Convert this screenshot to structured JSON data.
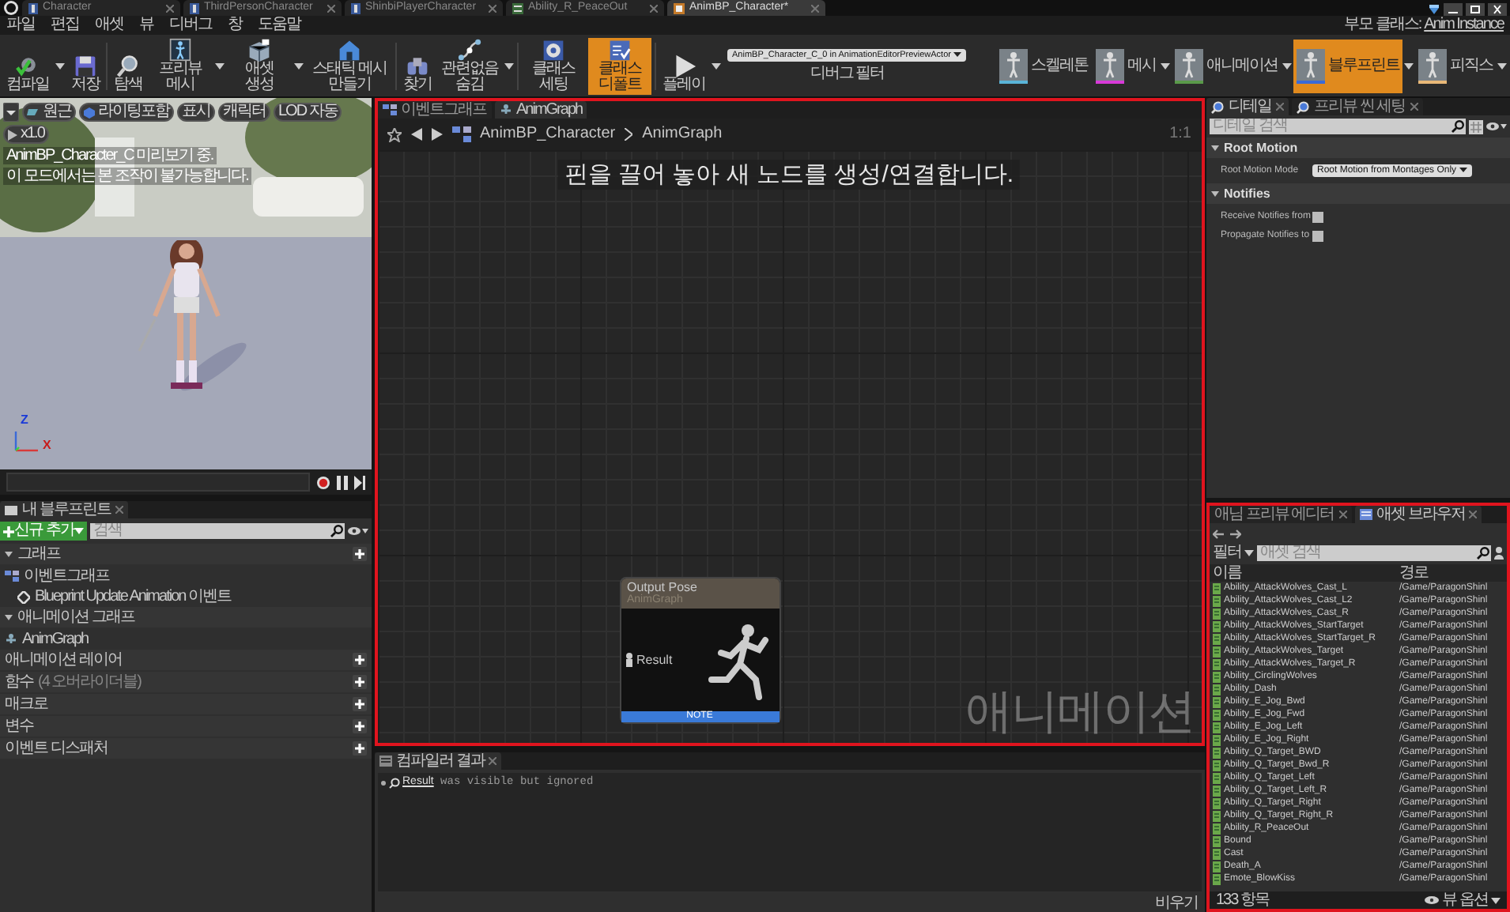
{
  "editor_tabs": [
    {
      "label": "Character",
      "kind": "blueprint",
      "selected": false
    },
    {
      "label": "ThirdPersonCharacter",
      "kind": "blueprint",
      "selected": false
    },
    {
      "label": "ShinbiPlayerCharacter",
      "kind": "blueprint",
      "selected": false
    },
    {
      "label": "Ability_R_PeaceOut",
      "kind": "sequence",
      "selected": false
    },
    {
      "label": "AnimBP_Character*",
      "kind": "animbp",
      "selected": true
    }
  ],
  "menu": [
    "파일",
    "편집",
    "애셋",
    "뷰",
    "디버그",
    "창",
    "도움말"
  ],
  "parent_class": {
    "label": "부모 클래스:",
    "value": "Anim Instance"
  },
  "toolbar": [
    {
      "label": "컴파일",
      "kind": "compile",
      "dropdown": true,
      "active": false
    },
    {
      "label": "저장",
      "kind": "save",
      "dropdown": false,
      "active": false
    },
    {
      "label": "탐색",
      "kind": "browse",
      "dropdown": false,
      "active": false
    },
    {
      "label": "프리뷰 메시",
      "kind": "preview",
      "dropdown": true,
      "active": false
    },
    {
      "label": "애셋 생성",
      "kind": "create",
      "dropdown": true,
      "active": false
    },
    {
      "label": "스태틱 메시 만들기",
      "kind": "house",
      "dropdown": false,
      "active": false
    },
    {
      "label": "찾기",
      "kind": "find",
      "dropdown": false,
      "active": false
    },
    {
      "label": "관련없음 숨김",
      "kind": "hide",
      "dropdown": true,
      "active": false
    },
    {
      "label": "클래스 세팅",
      "kind": "settings",
      "dropdown": false,
      "active": false
    },
    {
      "label": "클래스 디폴트",
      "kind": "defaults",
      "dropdown": false,
      "active": true
    },
    {
      "label": "플레이",
      "kind": "play",
      "dropdown": true,
      "active": false
    }
  ],
  "debug_filter": {
    "value": "AnimBP_Character_C_0 in AnimationEditorPreviewActor",
    "label": "디버그 필터"
  },
  "modes": [
    {
      "label": "스켈레톤",
      "color": "#5ab4d8",
      "dropdown": false,
      "selected": false
    },
    {
      "label": "메시",
      "color": "#d83ad8",
      "dropdown": true,
      "selected": false
    },
    {
      "label": "애니메이션",
      "color": "#5a9a4a",
      "dropdown": true,
      "selected": false
    },
    {
      "label": "블루프린트",
      "color": "#3a6ad8",
      "dropdown": true,
      "selected": true
    },
    {
      "label": "피직스",
      "color": "#e8b878",
      "dropdown": true,
      "selected": false
    }
  ],
  "viewport": {
    "buttons": [
      {
        "label": "원근",
        "kind": "perspective"
      },
      {
        "label": "라이팅포함",
        "kind": "lit"
      },
      {
        "label": "표시",
        "kind": "plain"
      },
      {
        "label": "캐릭터",
        "kind": "plain"
      },
      {
        "label": "LOD 자동",
        "kind": "plain"
      },
      {
        "label": "x1.0",
        "kind": "speed"
      }
    ],
    "messages": [
      "AnimBP_Character_C 미리보기 중.",
      "이 모드에서는 본 조작이 불가능합니다."
    ],
    "gizmo": [
      "Z",
      "X"
    ],
    "kind": "picture"
  },
  "my_blueprint": {
    "tab": "내 블루프린트",
    "add_button": "신규 추가",
    "search_placeholder": "검색",
    "sections": [
      {
        "label": "그래프",
        "add": true,
        "expanded": true,
        "children": [
          {
            "label": "이벤트그래프",
            "kind": "graph",
            "children": [
              {
                "label": "Blueprint Update Animation 이벤트",
                "kind": "event"
              }
            ]
          }
        ]
      },
      {
        "label": "애니메이션 그래프",
        "add": false,
        "expanded": true,
        "children": [
          {
            "label": "AnimGraph",
            "kind": "animgraph"
          }
        ]
      },
      {
        "label": "애니메이션 레이어",
        "add": true
      },
      {
        "label": "함수",
        "note": "(4 오버라이더블)",
        "add": true
      },
      {
        "label": "매크로",
        "add": true
      },
      {
        "label": "변수",
        "add": true
      },
      {
        "label": "이벤트 디스패처",
        "add": true
      }
    ]
  },
  "graph": {
    "tabs": [
      {
        "label": "이벤트그래프",
        "selected": false
      },
      {
        "label": "AnimGraph",
        "selected": true
      }
    ],
    "breadcrumb": [
      "AnimBP_Character",
      "AnimGraph"
    ],
    "zoom": "1:1",
    "hint": "핀을 끌어 놓아 새 노드를 생성/연결합니다.",
    "node": {
      "title": "Output Pose",
      "subtitle": "AnimGraph",
      "pin": "Result",
      "footer": "NOTE"
    },
    "watermark": "애니메이션"
  },
  "compiler": {
    "tab": "컴파일러 결과",
    "messages": [
      {
        "link": "Result",
        "text": "was visible but ignored"
      }
    ],
    "clear_button": "비우기"
  },
  "details": {
    "tabs": [
      {
        "label": "디테일",
        "selected": true
      },
      {
        "label": "프리뷰 씬 세팅",
        "selected": false
      }
    ],
    "search_placeholder": "디테일 검색",
    "categories": [
      {
        "title": "Root Motion",
        "expanded": true,
        "properties": [
          {
            "label": "Root Motion Mode",
            "kind": "dropdown",
            "value": "Root Motion from Montages Only"
          }
        ]
      },
      {
        "title": "Notifies",
        "expanded": true,
        "properties": [
          {
            "label": "Receive Notifies from",
            "kind": "checkbox",
            "checked": false
          },
          {
            "label": "Propagate Notifies to",
            "kind": "checkbox",
            "checked": false
          }
        ]
      }
    ]
  },
  "asset_browser": {
    "tabs": [
      {
        "label": "애님 프리뷰 에디터",
        "selected": false
      },
      {
        "label": "애셋 브라우저",
        "selected": true
      }
    ],
    "filter_button": "필터",
    "search_placeholder": "애셋 검색",
    "columns": [
      "이름",
      "경로"
    ],
    "rows": [
      {
        "name": "Ability_AttackWolves_Cast_L",
        "path": "/Game/ParagonShinl"
      },
      {
        "name": "Ability_AttackWolves_Cast_L2",
        "path": "/Game/ParagonShinl"
      },
      {
        "name": "Ability_AttackWolves_Cast_R",
        "path": "/Game/ParagonShinl"
      },
      {
        "name": "Ability_AttackWolves_StartTarget",
        "path": "/Game/ParagonShinl"
      },
      {
        "name": "Ability_AttackWolves_StartTarget_R",
        "path": "/Game/ParagonShinl"
      },
      {
        "name": "Ability_AttackWolves_Target",
        "path": "/Game/ParagonShinl"
      },
      {
        "name": "Ability_AttackWolves_Target_R",
        "path": "/Game/ParagonShinl"
      },
      {
        "name": "Ability_CirclingWolves",
        "path": "/Game/ParagonShinl"
      },
      {
        "name": "Ability_Dash",
        "path": "/Game/ParagonShinl"
      },
      {
        "name": "Ability_E_Jog_Bwd",
        "path": "/Game/ParagonShinl"
      },
      {
        "name": "Ability_E_Jog_Fwd",
        "path": "/Game/ParagonShinl"
      },
      {
        "name": "Ability_E_Jog_Left",
        "path": "/Game/ParagonShinl"
      },
      {
        "name": "Ability_E_Jog_Right",
        "path": "/Game/ParagonShinl"
      },
      {
        "name": "Ability_Q_Target_BWD",
        "path": "/Game/ParagonShinl"
      },
      {
        "name": "Ability_Q_Target_Bwd_R",
        "path": "/Game/ParagonShinl"
      },
      {
        "name": "Ability_Q_Target_Left",
        "path": "/Game/ParagonShinl"
      },
      {
        "name": "Ability_Q_Target_Left_R",
        "path": "/Game/ParagonShinl"
      },
      {
        "name": "Ability_Q_Target_Right",
        "path": "/Game/ParagonShinl"
      },
      {
        "name": "Ability_Q_Target_Right_R",
        "path": "/Game/ParagonShinl"
      },
      {
        "name": "Ability_R_PeaceOut",
        "path": "/Game/ParagonShinl"
      },
      {
        "name": "Bound",
        "path": "/Game/ParagonShinl"
      },
      {
        "name": "Cast",
        "path": "/Game/ParagonShinl"
      },
      {
        "name": "Death_A",
        "path": "/Game/ParagonShinl"
      },
      {
        "name": "Emote_BlowKiss",
        "path": "/Game/ParagonShinl"
      }
    ],
    "count": "133 항목",
    "view_options": "뷰 옵션"
  }
}
